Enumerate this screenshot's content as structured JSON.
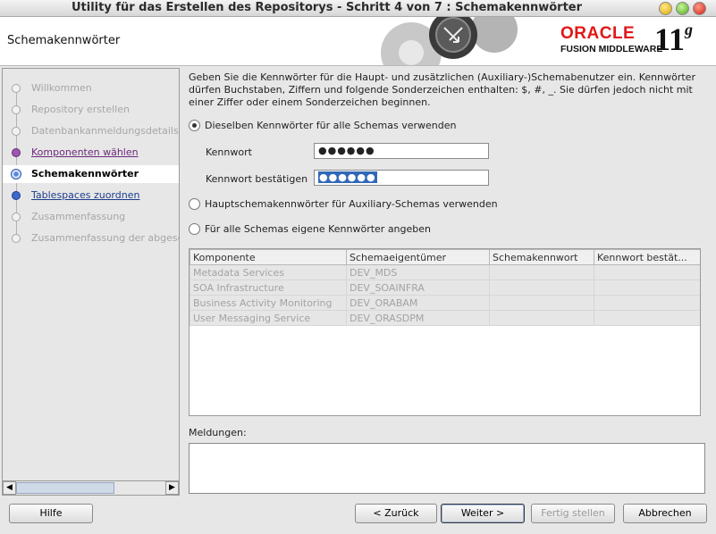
{
  "window": {
    "title": "Utility für das Erstellen des Repositorys - Schritt 4 von 7 : Schemakennwörter"
  },
  "banner": {
    "heading": "Schemakennwörter",
    "brand": "ORACLE",
    "product": "FUSION MIDDLEWARE",
    "version_number": "11",
    "version_letter": "g"
  },
  "steps": [
    {
      "label": "Willkommen",
      "state": "done"
    },
    {
      "label": "Repository erstellen",
      "state": "done"
    },
    {
      "label": "Datenbankanmeldungsdetails",
      "state": "done"
    },
    {
      "label": "Komponenten wählen",
      "state": "visited"
    },
    {
      "label": "Schemakennwörter",
      "state": "current"
    },
    {
      "label": "Tablespaces zuordnen",
      "state": "link"
    },
    {
      "label": "Zusammenfassung",
      "state": "pending"
    },
    {
      "label": "Zusammenfassung der abgeschlossenen",
      "state": "pending"
    }
  ],
  "content": {
    "intro": "Geben Sie die Kennwörter für die Haupt- und zusätzlichen (Auxiliary-)Schemabenutzer ein. Kennwörter dürfen Buchstaben, Ziffern und folgende Sonderzeichen enthalten: $, #, _. Sie dürfen jedoch nicht mit einer Ziffer oder einem Sonderzeichen beginnen.",
    "option1": "Dieselben Kennwörter für alle Schemas verwenden",
    "password_label": "Kennwort",
    "password_value": "●●●●●●",
    "confirm_label": "Kennwort bestätigen",
    "confirm_value": "●●●●●●",
    "option2": "Hauptschemakennwörter für Auxiliary-Schemas verwenden",
    "option3": "Für alle Schemas eigene Kennwörter angeben",
    "table": {
      "headers": [
        "Komponente",
        "Schemaeigentümer",
        "Schemakennwort",
        "Kennwort bestät..."
      ],
      "rows": [
        [
          "Metadata Services",
          "DEV_MDS",
          "",
          ""
        ],
        [
          "SOA Infrastructure",
          "DEV_SOAINFRA",
          "",
          ""
        ],
        [
          "Business Activity Monitoring",
          "DEV_ORABAM",
          "",
          ""
        ],
        [
          "User Messaging Service",
          "DEV_ORASDPM",
          "",
          ""
        ]
      ]
    },
    "messages_label": "Meldungen:"
  },
  "buttons": {
    "help": "Hilfe",
    "back": "< Zurück",
    "next": "Weiter >",
    "finish": "Fertig stellen",
    "cancel": "Abbrechen"
  }
}
